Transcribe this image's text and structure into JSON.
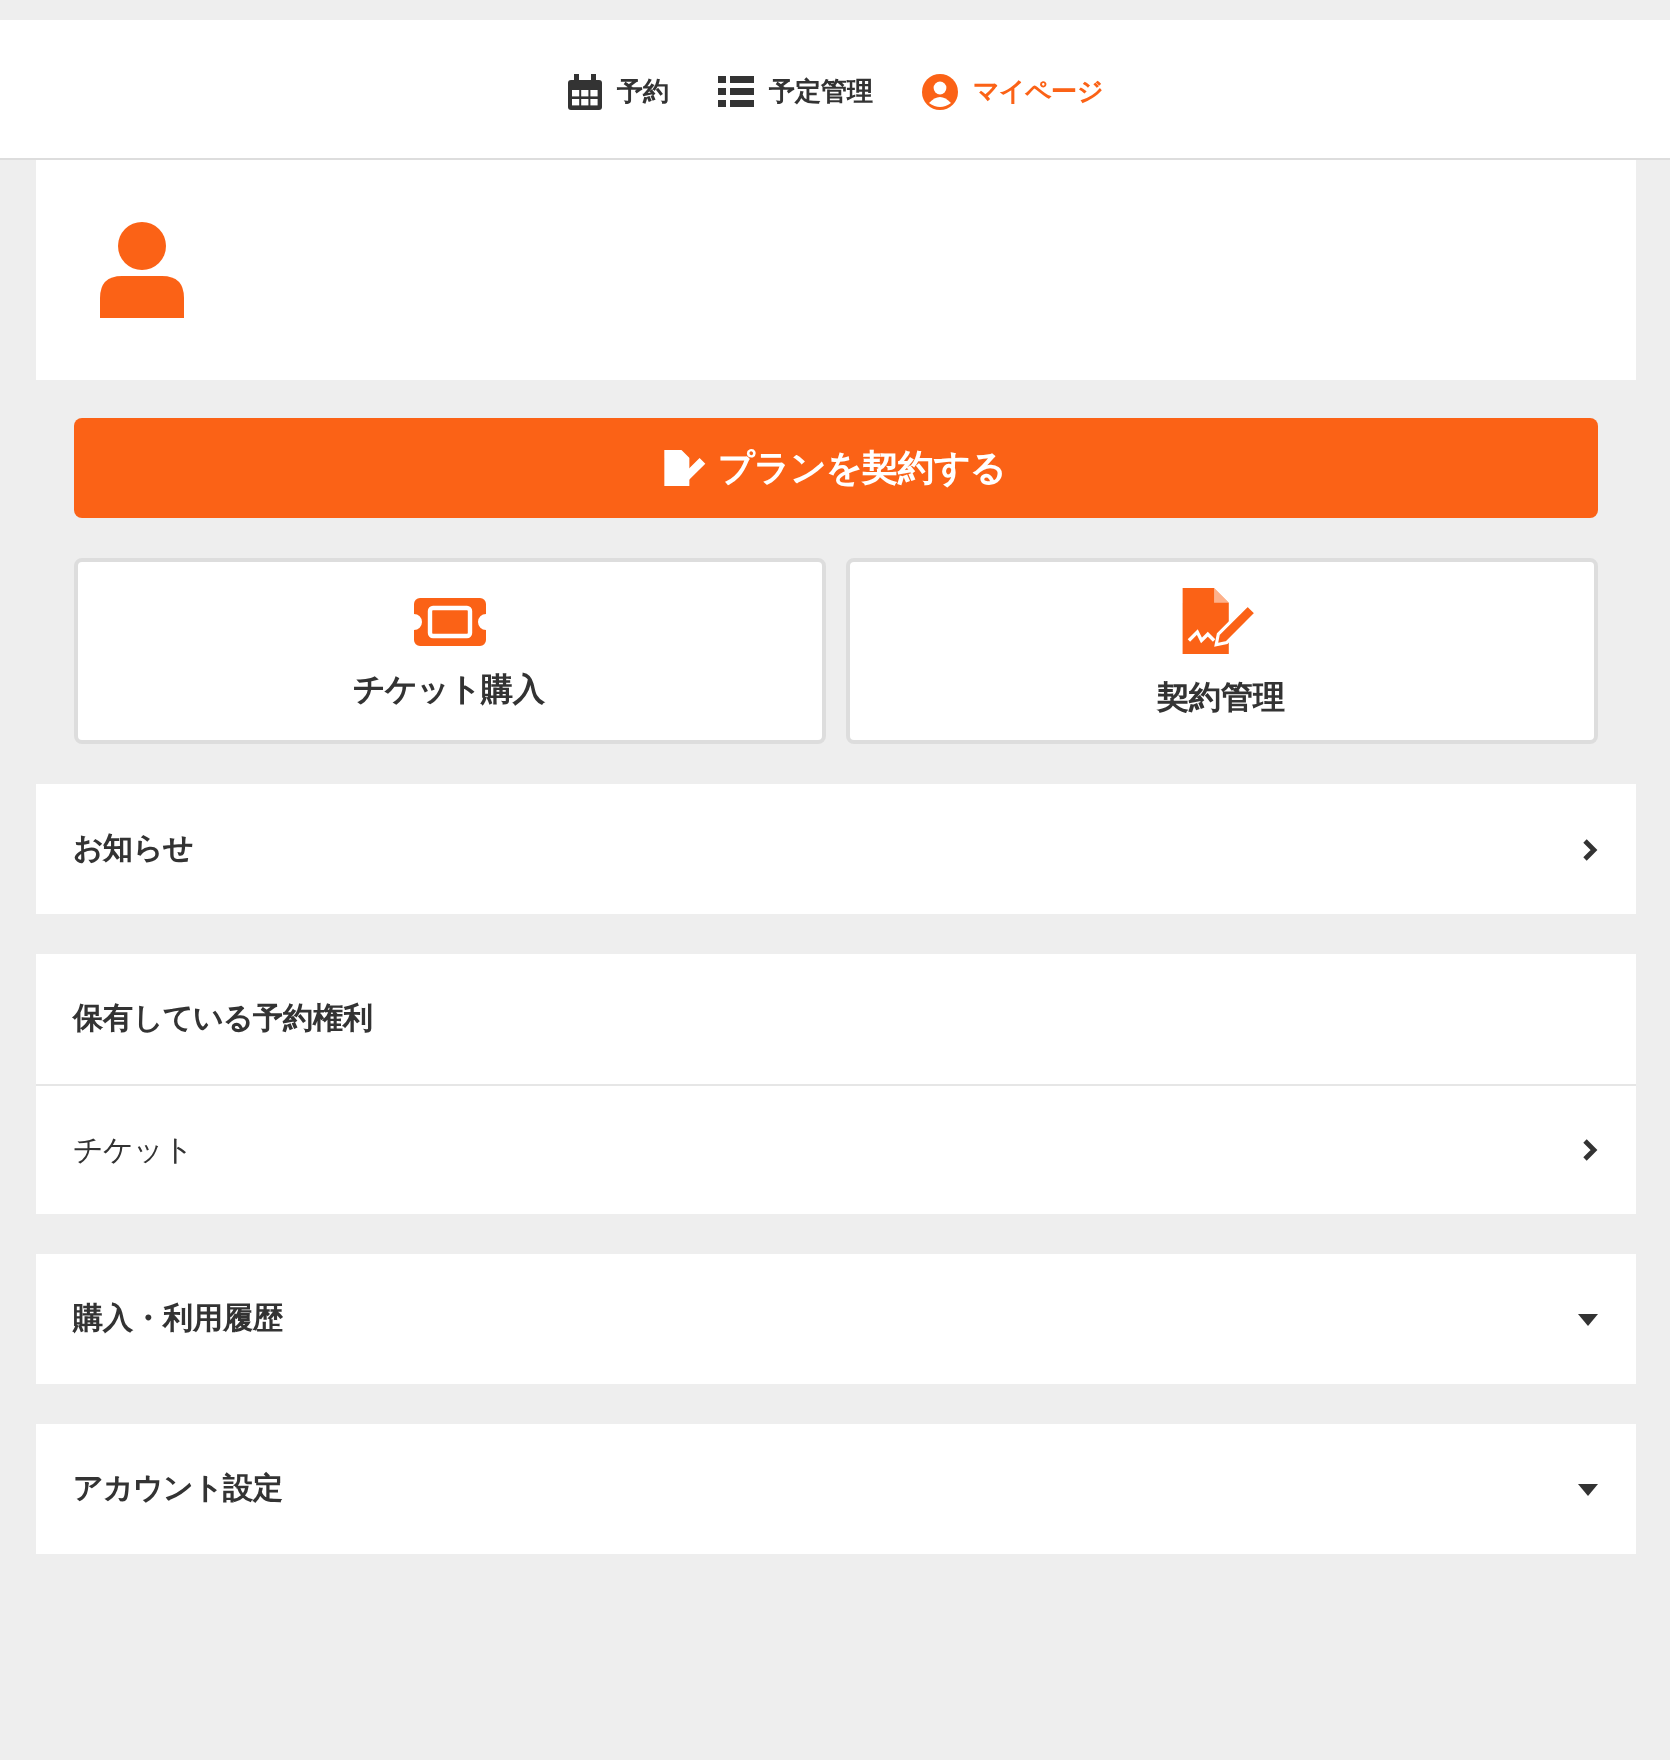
{
  "nav": [
    {
      "kind": "calendar",
      "label": "予約",
      "selected": false
    },
    {
      "kind": "list",
      "label": "予定管理",
      "selected": false
    },
    {
      "kind": "user",
      "label": "マイページ",
      "selected": true
    }
  ],
  "primary_button": {
    "label": "プランを契約する"
  },
  "tiles": [
    {
      "kind": "ticket",
      "label": "チケット購入"
    },
    {
      "kind": "contract",
      "label": "契約管理"
    }
  ],
  "sections": [
    {
      "kind": "link",
      "title": "お知らせ"
    },
    {
      "kind": "group",
      "title": "保有している予約権利",
      "items": [
        {
          "label": "チケット"
        }
      ]
    },
    {
      "kind": "dropdown",
      "title": "購入・利用履歴",
      "expanded": false
    },
    {
      "kind": "dropdown",
      "title": "アカウント設定",
      "expanded": false
    }
  ]
}
